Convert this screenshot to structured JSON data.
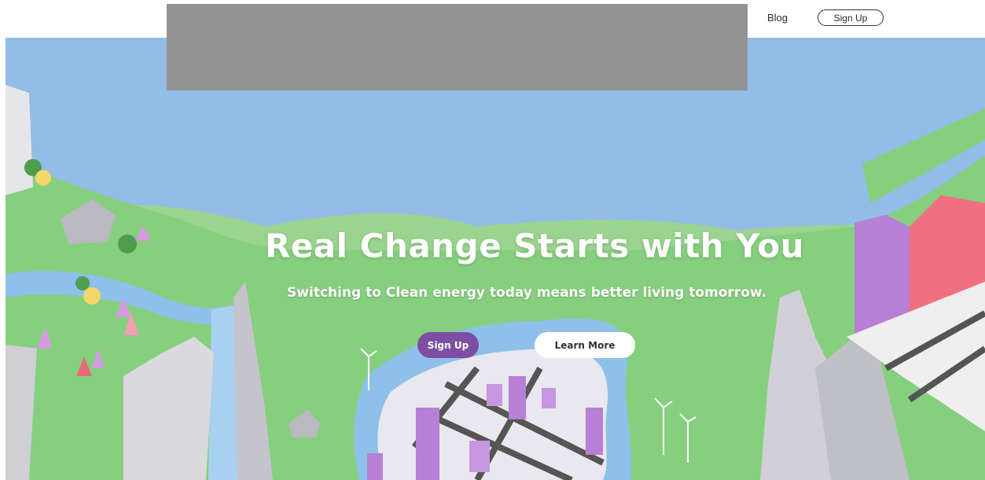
{
  "nav": {
    "blog_label": "Blog",
    "signup_label": "Sign Up"
  },
  "hero": {
    "headline": "Real Change Starts with You",
    "subheadline": "Switching to Clean energy today means better living tomorrow.",
    "primary_cta": "Sign Up",
    "secondary_cta": "Learn More"
  },
  "colors": {
    "sky": "#93bde6",
    "grass": "#86cf7e",
    "water": "#8ec0ea",
    "cliff": "#d4d4d8",
    "accent_purple": "#7d4fa3",
    "building_purple": "#b77fd6",
    "building_pink": "#f0707f"
  }
}
